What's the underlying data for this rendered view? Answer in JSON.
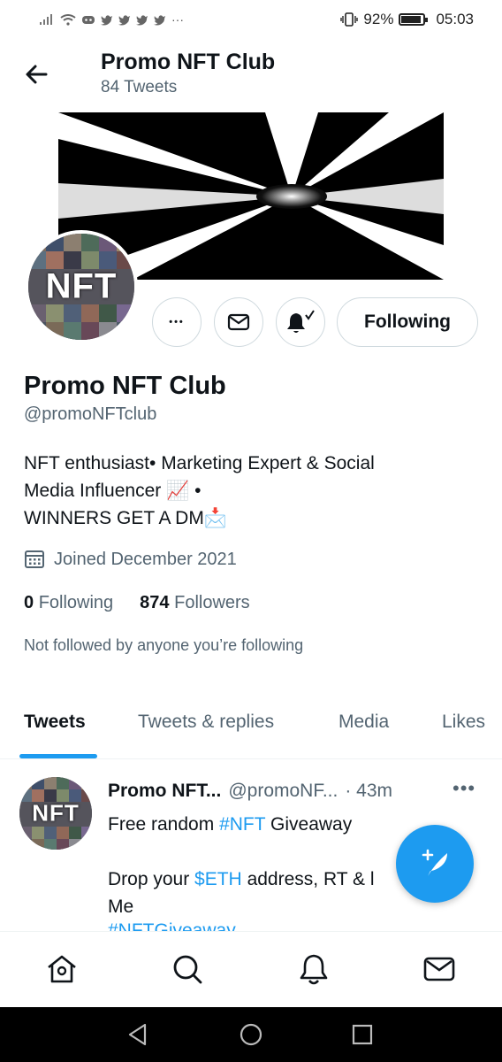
{
  "status_bar": {
    "battery": "92%",
    "battery_level": 0.92,
    "time": "05:03",
    "overflow": "···"
  },
  "header": {
    "title": "Promo NFT Club",
    "subtitle": "84 Tweets"
  },
  "profile": {
    "avatar_text": "NFT",
    "name": "Promo NFT Club",
    "handle": "@promoNFTclub",
    "bio_line1": "NFT enthusiast• Marketing Expert & Social",
    "bio_line2": "Media Influencer 📈 •",
    "bio_line3": "WINNERS GET A DM📩",
    "joined": "Joined December 2021",
    "following_count": "0",
    "following_label": "Following",
    "followers_count": "874",
    "followers_label": "Followers",
    "not_followed": "Not followed by anyone you’re following"
  },
  "actions": {
    "more": "•••",
    "following_button": "Following"
  },
  "tabs": [
    "Tweets",
    "Tweets & replies",
    "Media",
    "Likes"
  ],
  "tweet": {
    "avatar_text": "NFT",
    "name": "Promo NFT...",
    "handle": "@promoNF...",
    "time": "· 43m",
    "more": "•••",
    "line1_pre": "Free random ",
    "line1_tag": "#NFT",
    "line1_post": " Giveaway",
    "line2_pre": "Drop your ",
    "line2_tag": "$ETH",
    "line2_post": " address, RT & l",
    "line3": "Me",
    "line4_tag": "#NFTGiveaway"
  },
  "colors": {
    "accent": "#1d9bf0",
    "text": "#0f1419",
    "muted": "#536471"
  },
  "icons": [
    "back-arrow-icon",
    "more-icon",
    "mail-icon",
    "bell-icon",
    "calendar-icon",
    "compose-icon",
    "home-icon",
    "search-icon",
    "notifications-icon",
    "messages-icon"
  ]
}
